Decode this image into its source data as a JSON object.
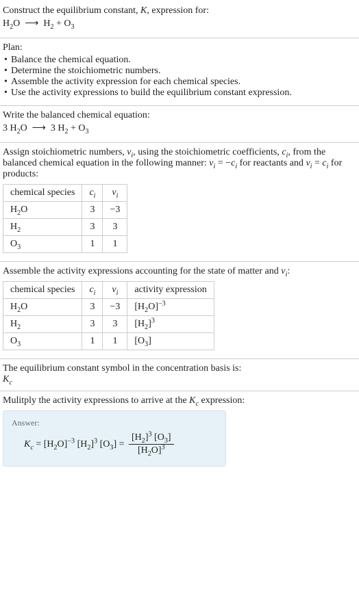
{
  "s1": {
    "line1_a": "Construct the equilibrium constant, ",
    "line1_b": ", expression for:",
    "eq_html": "H<sub>2</sub>O &nbsp;⟶&nbsp; H<sub>2</sub> + O<sub>3</sub>"
  },
  "s2": {
    "title": "Plan:",
    "b1": "Balance the chemical equation.",
    "b2": "Determine the stoichiometric numbers.",
    "b3": "Assemble the activity expression for each chemical species.",
    "b4": "Use the activity expressions to build the equilibrium constant expression."
  },
  "s3": {
    "title": "Write the balanced chemical equation:",
    "eq_html": "3 H<sub>2</sub>O &nbsp;⟶&nbsp; 3 H<sub>2</sub> + O<sub>3</sub>"
  },
  "s4": {
    "intro_a": "Assign stoichiometric numbers, ",
    "intro_b": ", using the stoichiometric coefficients, ",
    "intro_c": ", from the balanced chemical equation in the following manner: ",
    "intro_d": " for reactants and ",
    "intro_e": " for products:",
    "nu_html": "<span class=\"italic-var\">ν<sub>i</sub></span>",
    "ci_html": "<span class=\"italic-var\">c<sub>i</sub></span>",
    "rel1_html": "<span class=\"italic-var\">ν<sub>i</sub></span> = −<span class=\"italic-var\">c<sub>i</sub></span>",
    "rel2_html": "<span class=\"italic-var\">ν<sub>i</sub></span> = <span class=\"italic-var\">c<sub>i</sub></span>",
    "h_species": "chemical species",
    "h_ci_html": "<span class=\"italic-var\">c<sub>i</sub></span>",
    "h_nu_html": "<span class=\"italic-var\">ν<sub>i</sub></span>",
    "rows": [
      {
        "sp_html": "H<sub>2</sub>O",
        "ci": "3",
        "nu": "−3"
      },
      {
        "sp_html": "H<sub>2</sub>",
        "ci": "3",
        "nu": "3"
      },
      {
        "sp_html": "O<sub>3</sub>",
        "ci": "1",
        "nu": "1"
      }
    ]
  },
  "s5": {
    "intro_a": "Assemble the activity expressions accounting for the state of matter and ",
    "intro_b": ":",
    "nu_html": "<span class=\"italic-var\">ν<sub>i</sub></span>",
    "h_species": "chemical species",
    "h_ci_html": "<span class=\"italic-var\">c<sub>i</sub></span>",
    "h_nu_html": "<span class=\"italic-var\">ν<sub>i</sub></span>",
    "h_activity": "activity expression",
    "rows": [
      {
        "sp_html": "H<sub>2</sub>O",
        "ci": "3",
        "nu": "−3",
        "act_html": "[H<sub>2</sub>O]<sup>−3</sup>"
      },
      {
        "sp_html": "H<sub>2</sub>",
        "ci": "3",
        "nu": "3",
        "act_html": "[H<sub>2</sub>]<sup>3</sup>"
      },
      {
        "sp_html": "O<sub>3</sub>",
        "ci": "1",
        "nu": "1",
        "act_html": "[O<sub>3</sub>]"
      }
    ]
  },
  "s6": {
    "line": "The equilibrium constant symbol in the concentration basis is:",
    "sym_html": "<span class=\"italic-var\">K<sub>c</sub></span>"
  },
  "s7": {
    "line_a": "Mulitply the activity expressions to arrive at the ",
    "line_b": " expression:",
    "kc_html": "<span class=\"italic-var\">K<sub>c</sub></span>",
    "answer_label": "Answer:",
    "lhs_html": "<span class=\"italic-var\">K<sub>c</sub></span> = [H<sub>2</sub>O]<sup>−3</sup> [H<sub>2</sub>]<sup>3</sup> [O<sub>3</sub>] = ",
    "num_html": "[H<sub>2</sub>]<sup>3</sup> [O<sub>3</sub>]",
    "den_html": "[H<sub>2</sub>O]<sup>3</sup>"
  },
  "chart_data": {
    "type": "table",
    "tables": [
      {
        "title": "Stoichiometric numbers",
        "columns": [
          "chemical species",
          "c_i",
          "ν_i"
        ],
        "rows": [
          [
            "H2O",
            3,
            -3
          ],
          [
            "H2",
            3,
            3
          ],
          [
            "O3",
            1,
            1
          ]
        ]
      },
      {
        "title": "Activity expressions",
        "columns": [
          "chemical species",
          "c_i",
          "ν_i",
          "activity expression"
        ],
        "rows": [
          [
            "H2O",
            3,
            -3,
            "[H2O]^-3"
          ],
          [
            "H2",
            3,
            3,
            "[H2]^3"
          ],
          [
            "O3",
            1,
            1,
            "[O3]"
          ]
        ]
      }
    ],
    "equations": {
      "unbalanced": "H2O -> H2 + O3",
      "balanced": "3 H2O -> 3 H2 + O3",
      "Kc": "Kc = [H2]^3 [O3] / [H2O]^3"
    }
  }
}
